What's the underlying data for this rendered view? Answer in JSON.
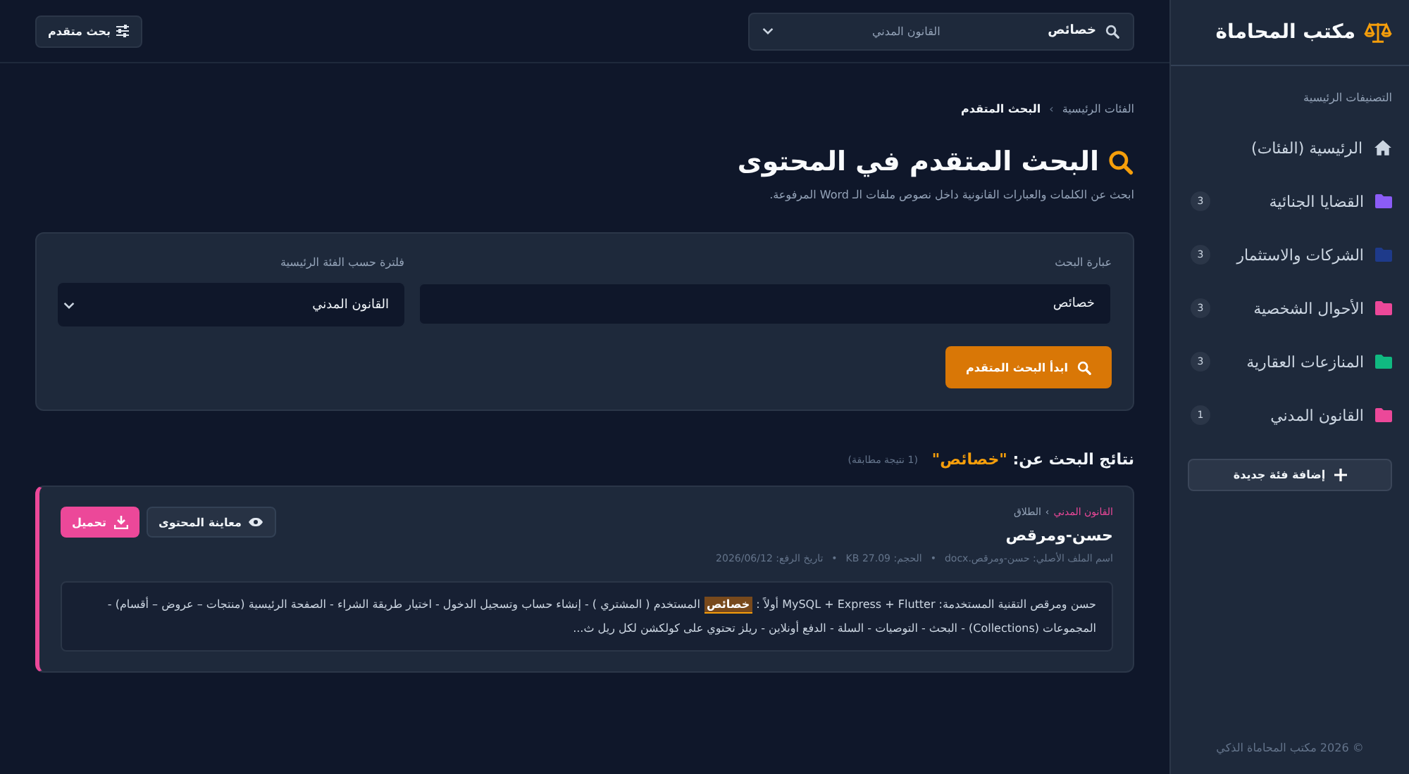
{
  "sidebar": {
    "brand": "مكتب المحاماة",
    "section_title": "التصنيفات الرئيسية",
    "items": [
      {
        "kind": "home",
        "label": "الرئيسية (الفئات)",
        "selected": false
      },
      {
        "kind": "folder",
        "label": "القضايا الجنائية",
        "count": "3",
        "color": "#8b5cf6",
        "selected": false
      },
      {
        "kind": "folder",
        "label": "الشركات والاستثمار",
        "count": "3",
        "color": "#1e3a8a",
        "selected": false
      },
      {
        "kind": "folder",
        "label": "الأحوال الشخصية",
        "count": "3",
        "color": "#ec4899",
        "selected": false
      },
      {
        "kind": "folder",
        "label": "المنازعات العقارية",
        "count": "3",
        "color": "#10b981",
        "selected": false
      },
      {
        "kind": "folder",
        "label": "القانون المدني",
        "count": "1",
        "color": "#ec4899",
        "selected": false
      }
    ],
    "add_button": "إضافة فئة جديدة",
    "footer": "© 2026 مكتب المحاماة الذكي"
  },
  "topbar": {
    "search_value": "خصائص",
    "category_value": "القانون المدني",
    "advanced_button": "بحث متقدم"
  },
  "breadcrumb": [
    "الفئات الرئيسية",
    "البحث المتقدم"
  ],
  "breadcrumb_separator": "›",
  "page_title": "البحث المتقدم في المحتوى",
  "page_subtitle": "ابحث عن الكلمات والعبارات القانونية داخل نصوص ملفات الـ Word المرفوعة.",
  "form": {
    "phrase_label": "عبارة البحث",
    "phrase_value": "خصائص",
    "filter_label": "فلترة حسب الفئة الرئيسية",
    "filter_value": "القانون المدني",
    "submit": "ابدأ البحث المتقدم"
  },
  "results": {
    "heading": "نتائج البحث عن:",
    "query": "\"خصائص\"",
    "count": "(1 نتيجة مطابقة)",
    "items": [
      {
        "category": "القانون المدني",
        "subcategory": "الطلاق",
        "category_separator": "›",
        "meta_separator": "•",
        "title": "حسن-ومرقص",
        "meta": [
          "اسم الملف الأصلي: حسن-ومرقص.docx",
          "الحجم: 27.09 KB",
          "تاريخ الرفع: 2026/06/12"
        ],
        "preview_button": "معاينة المحتوى",
        "download_button": "تحميل",
        "snippet_before": "حسن ومرقص التقنية المستخدمة: MySQL + Express + Flutter أولاً : ",
        "snippet_match": "خصائص",
        "snippet_after": " المستخدم ( المشتري ) - إنشاء حساب وتسجيل الدخول - اختيار طريقة الشراء - الصفحة الرئيسية (منتجات – عروض – أقسام) - المجموعات (Collections) - البحث - التوصيات - السلة - الدفع أونلاين - ريلز تحتوي على كولكشن لكل ريل ث..."
      }
    ]
  }
}
